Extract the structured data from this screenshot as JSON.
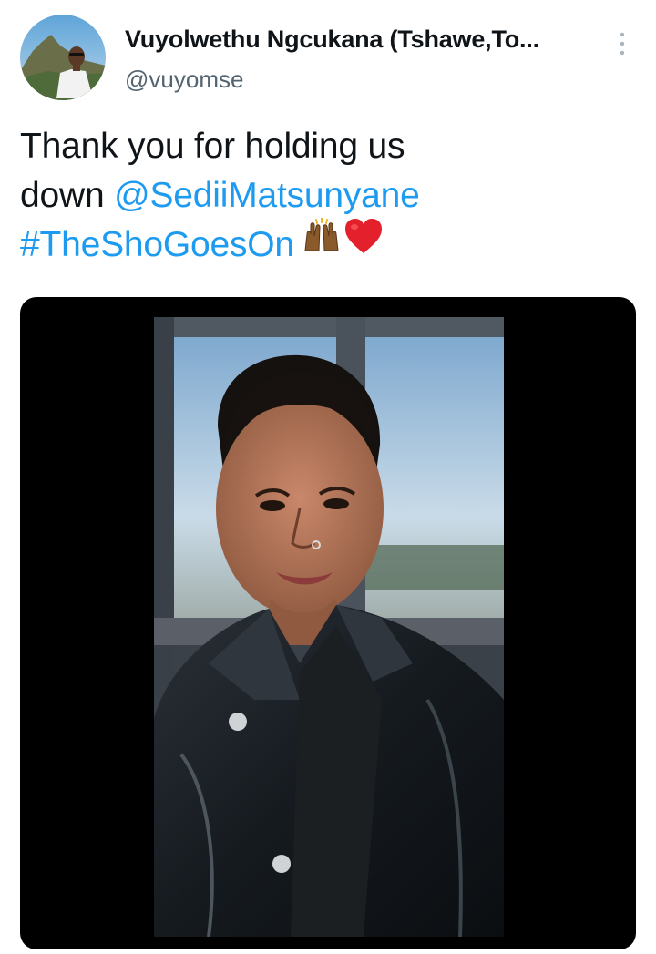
{
  "tweet": {
    "author_name": "Vuyolwethu Ngcukana (Tshawe,To...",
    "author_handle": "@vuyomse",
    "text_line1": "Thank you for holding us",
    "text_line2_prefix": "down ",
    "mention": "@SediiMatsunyane",
    "hashtag": "#TheShoGoesOn",
    "emojis": [
      "raising-hands-emoji",
      "red-heart-emoji"
    ]
  },
  "colors": {
    "link": "#1d9bf0",
    "text": "#0f1419",
    "secondary": "#536471",
    "media_bg": "#000000"
  },
  "icons": {
    "more": "vertical-ellipsis-icon"
  }
}
